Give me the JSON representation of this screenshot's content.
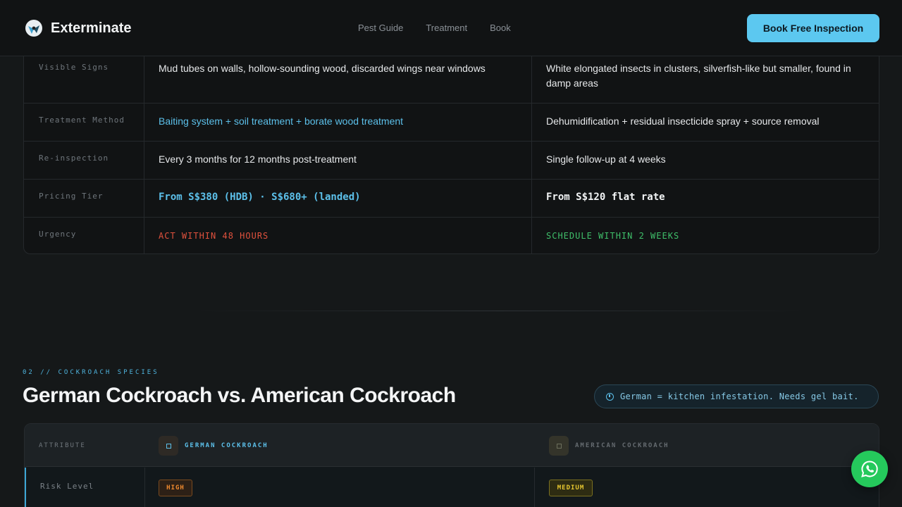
{
  "nav": {
    "brand": "Exterminate",
    "links": [
      "Pest Guide",
      "Treatment",
      "Book"
    ],
    "cta": "Book Free Inspection"
  },
  "termite_table": {
    "rows": [
      {
        "label": "Visible Signs",
        "a": "Mud tubes on walls, hollow-sounding wood, discarded wings near windows",
        "b": "White elongated insects in clusters, silverfish-like but smaller, found in damp areas"
      },
      {
        "label": "Treatment Method",
        "a": "Baiting system + soil treatment + borate wood treatment",
        "b": "Dehumidification + residual insecticide spray + source removal"
      },
      {
        "label": "Re-inspection",
        "a": "Every 3 months for 12 months post-treatment",
        "b": "Single follow-up at 4 weeks"
      },
      {
        "label": "Pricing Tier",
        "a": "From S$380 (HDB) · S$680+ (landed)",
        "b": "From S$120 flat rate"
      },
      {
        "label": "Urgency",
        "a": "ACT WITHIN 48 HOURS",
        "b": "SCHEDULE WITHIN 2 WEEKS"
      }
    ]
  },
  "section": {
    "eyebrow": "02 // COCKROACH SPECIES",
    "title": "German Cockroach vs. American Cockroach",
    "pill": "German = kitchen infestation. Needs gel bait."
  },
  "cockroach_table": {
    "header": {
      "attr": "ATTRIBUTE",
      "col_a": "GERMAN COCKROACH",
      "col_b": "AMERICAN COCKROACH"
    },
    "rows": [
      {
        "label": "Risk Level",
        "a": "HIGH",
        "b": "MEDIUM"
      }
    ]
  },
  "colors": {
    "accent": "#5cc8f0",
    "urgent": "#e0513d",
    "ok": "#3fbf6a",
    "whatsapp": "#25c95c"
  }
}
